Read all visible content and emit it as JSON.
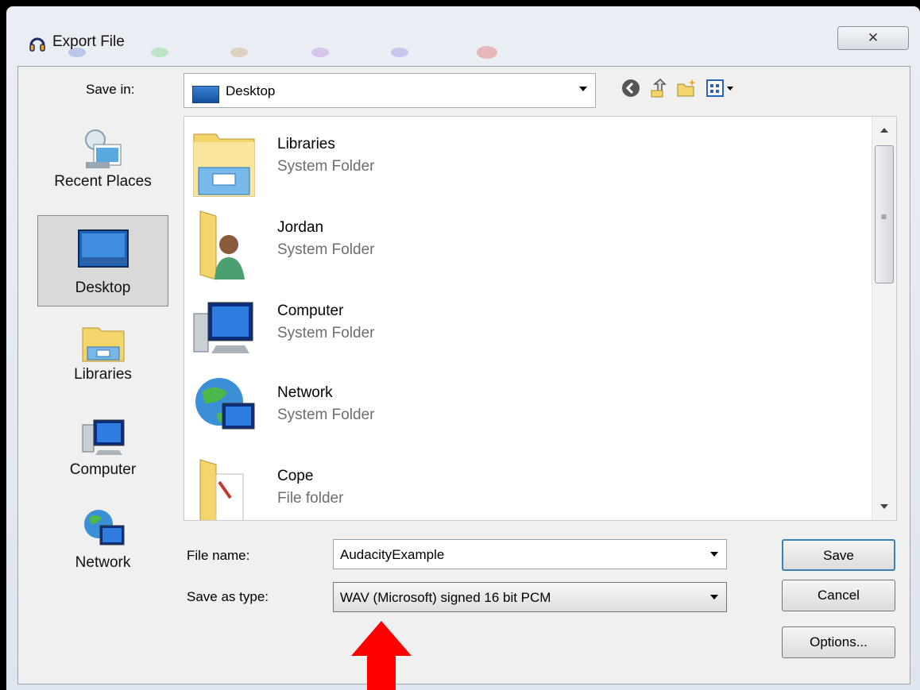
{
  "window": {
    "title": "Export File",
    "close_glyph": "✕"
  },
  "colors": {
    "arrow_annotation": "#ff0000",
    "selected_place_bg": "#d9d9d9"
  },
  "toolbar": {
    "save_in_label": "Save in:",
    "save_in_value": "Desktop",
    "icons": [
      "back-icon",
      "up-folder-icon",
      "new-folder-icon",
      "view-menu-icon"
    ]
  },
  "places": [
    {
      "label": "Recent Places",
      "icon": "recent-places-icon",
      "selected": false
    },
    {
      "label": "Desktop",
      "icon": "desktop-icon",
      "selected": true
    },
    {
      "label": "Libraries",
      "icon": "libraries-icon",
      "selected": false
    },
    {
      "label": "Computer",
      "icon": "computer-icon",
      "selected": false
    },
    {
      "label": "Network",
      "icon": "network-icon",
      "selected": false
    }
  ],
  "files": [
    {
      "name": "Libraries",
      "type": "System Folder",
      "icon": "libraries-folder-icon"
    },
    {
      "name": "Jordan",
      "type": "System Folder",
      "icon": "user-folder-icon"
    },
    {
      "name": "Computer",
      "type": "System Folder",
      "icon": "computer-icon"
    },
    {
      "name": "Network",
      "type": "System Folder",
      "icon": "network-icon"
    },
    {
      "name": "Cope",
      "type": "File folder",
      "icon": "folder-icon"
    }
  ],
  "form": {
    "file_name_label": "File name:",
    "file_name_value": "AudacityExample",
    "save_type_label": "Save as type:",
    "save_type_value": "WAV (Microsoft) signed 16 bit PCM"
  },
  "buttons": {
    "save": "Save",
    "cancel": "Cancel",
    "options": "Options..."
  }
}
